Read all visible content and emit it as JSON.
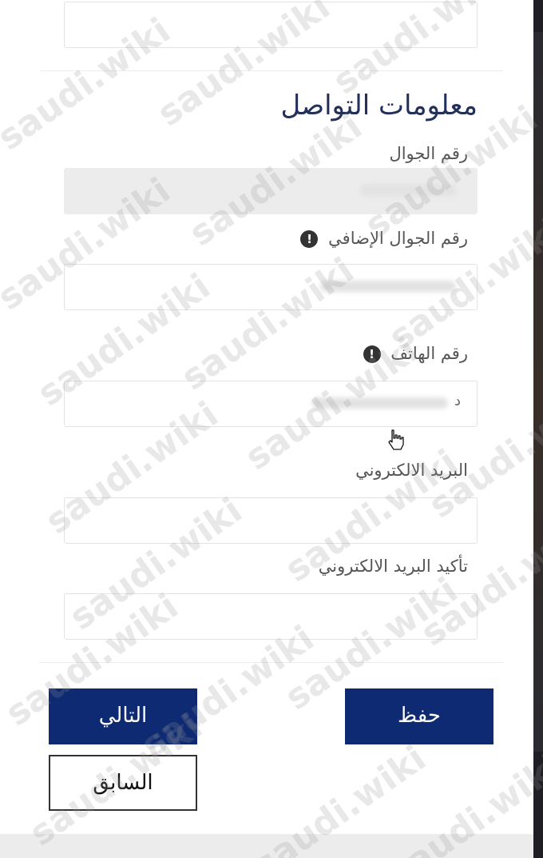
{
  "form": {
    "section_title": "معلومات التواصل",
    "fields": [
      {
        "label": "رقم الجوال"
      },
      {
        "label": "رقم الجوال الإضافي"
      },
      {
        "label": "رقم الهاتف",
        "value": "د"
      },
      {
        "label": "البريد الالكتروني"
      },
      {
        "label": "تأكيد البريد الالكتروني"
      }
    ]
  },
  "buttons": {
    "next": "التالي",
    "save": "حفظ",
    "previous": "السابق"
  },
  "watermark": "saudi.wiki",
  "icons": {
    "info": "exclamation-icon",
    "pointer": "hand-cursor-icon"
  },
  "colors": {
    "primary": "#0d2a72",
    "title": "#23305a"
  }
}
